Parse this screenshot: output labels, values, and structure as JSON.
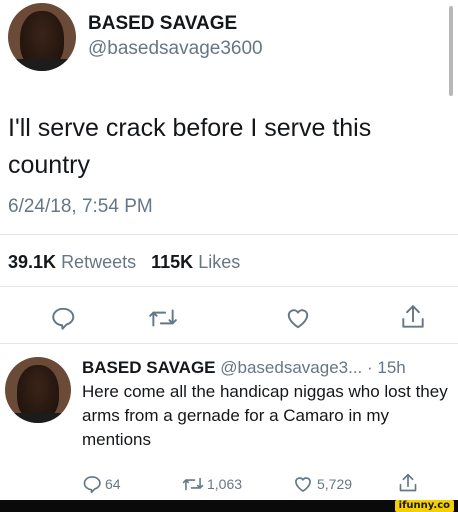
{
  "tweet": {
    "display_name": "BASED SAVAGE",
    "handle": "@basedsavage3600",
    "text": "I'll serve crack before I serve this country",
    "timestamp": "6/24/18, 7:54 PM",
    "retweets_count": "39.1K",
    "retweets_label": "Retweets",
    "likes_count": "115K",
    "likes_label": "Likes"
  },
  "actions": {
    "reply_icon": "reply-icon",
    "retweet_icon": "retweet-icon",
    "like_icon": "heart-icon",
    "share_icon": "share-icon"
  },
  "reply": {
    "display_name": "BASED SAVAGE",
    "handle": "@basedsavage3...",
    "time": "· 15h",
    "text": "Here come all the handicap niggas who lost they arms from a gernade for a Camaro in my mentions",
    "reply_count": "64",
    "retweet_count": "1,063",
    "like_count": "5,729"
  },
  "watermark": {
    "text": "ifunny.co"
  },
  "colors": {
    "text": "#14171a",
    "muted": "#657786",
    "divider": "#e1e8ed",
    "watermark_bg": "#f5d000"
  }
}
